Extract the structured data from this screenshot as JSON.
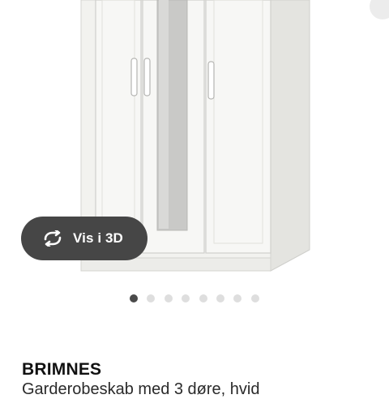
{
  "product_image": {
    "icon": "wardrobe-image"
  },
  "view_3d": {
    "label": "Vis i 3D",
    "icon": "rotate-360-icon",
    "background": "#464646"
  },
  "gallery": {
    "dot_count": 8,
    "active_index": 1,
    "active_color": "#4a4a4a",
    "inactive_color": "#dedede"
  },
  "product": {
    "name": "BRIMNES",
    "description": "Garderobeskab med 3 døre, hvid"
  }
}
